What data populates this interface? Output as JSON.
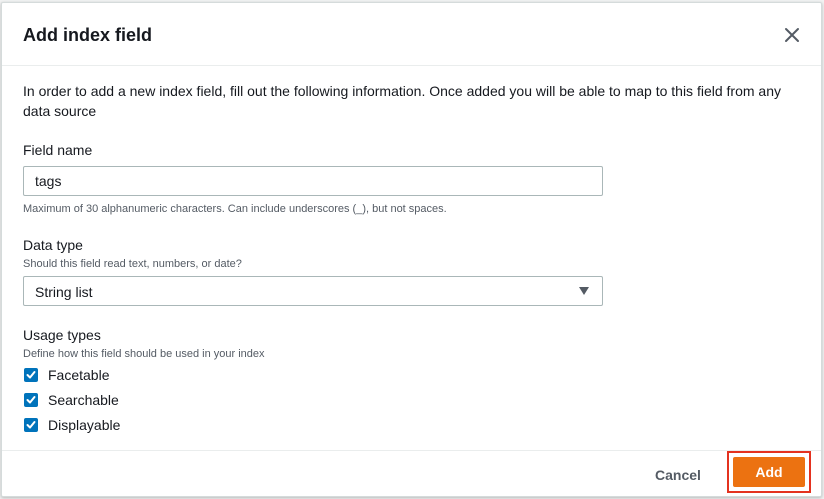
{
  "modal": {
    "title": "Add index field",
    "close_icon": "close-icon",
    "intro": "In order to add a new index field, fill out the following information. Once added you will be able to map to this field from any data source"
  },
  "field_name": {
    "label": "Field name",
    "value": "tags",
    "hint": "Maximum of 30 alphanumeric characters. Can include underscores (_), but not spaces."
  },
  "data_type": {
    "label": "Data type",
    "description": "Should this field read text, numbers, or date?",
    "selected": "String list",
    "caret_icon": "caret-down-icon"
  },
  "usage_types": {
    "label": "Usage types",
    "description": "Define how this field should be used in your index",
    "options": [
      {
        "label": "Facetable",
        "checked": true
      },
      {
        "label": "Searchable",
        "checked": true
      },
      {
        "label": "Displayable",
        "checked": true
      }
    ]
  },
  "footer": {
    "cancel_label": "Cancel",
    "add_label": "Add"
  },
  "colors": {
    "primary_button": "#ec7211",
    "checkbox": "#0073bb",
    "highlight": "#e4321f"
  }
}
